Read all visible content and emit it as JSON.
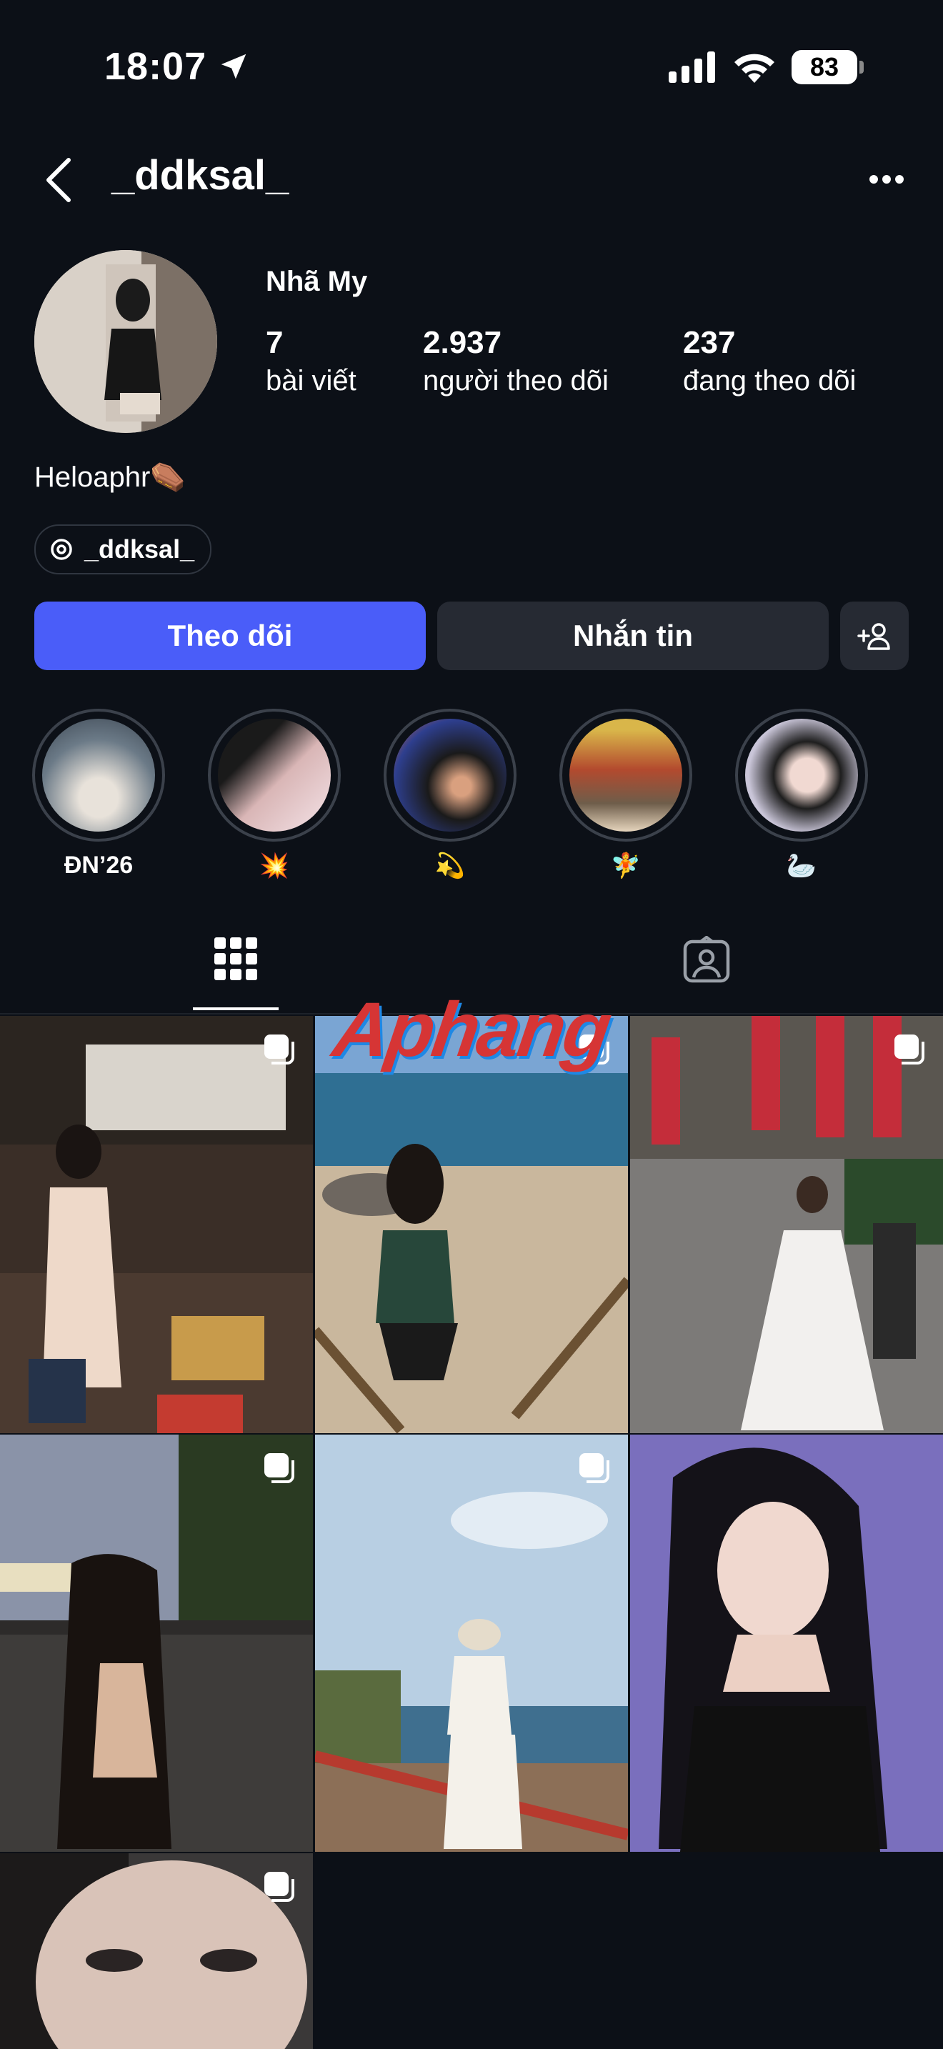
{
  "status_bar": {
    "time": "18:07",
    "battery": "83"
  },
  "header": {
    "username": "_ddksal_"
  },
  "profile": {
    "display_name": "Nhã My",
    "stats": [
      {
        "value": "7",
        "label": "bài viết"
      },
      {
        "value": "2.937",
        "label": "người theo dõi"
      },
      {
        "value": "237",
        "label": "đang theo dõi"
      }
    ],
    "bio": "Heloaphr⚰️",
    "threads_handle": "_ddksal_"
  },
  "actions": {
    "follow_label": "Theo dõi",
    "message_label": "Nhắn tin"
  },
  "highlights": [
    {
      "label": "ĐN’26"
    },
    {
      "label": "💥"
    },
    {
      "label": "💫"
    },
    {
      "label": "🧚"
    },
    {
      "label": "🦢"
    }
  ],
  "tabs": [
    {
      "icon": "grid-icon",
      "active": true
    },
    {
      "icon": "tagged-icon",
      "active": false
    }
  ],
  "posts": [
    {
      "type": "carousel"
    },
    {
      "type": "carousel"
    },
    {
      "type": "carousel"
    },
    {
      "type": "carousel"
    },
    {
      "type": "carousel"
    },
    {
      "type": "single"
    },
    {
      "type": "carousel"
    }
  ],
  "watermark": "Aphang",
  "colors": {
    "background": "#0c1017",
    "accent": "#4a5df9",
    "button": "#262a33"
  }
}
